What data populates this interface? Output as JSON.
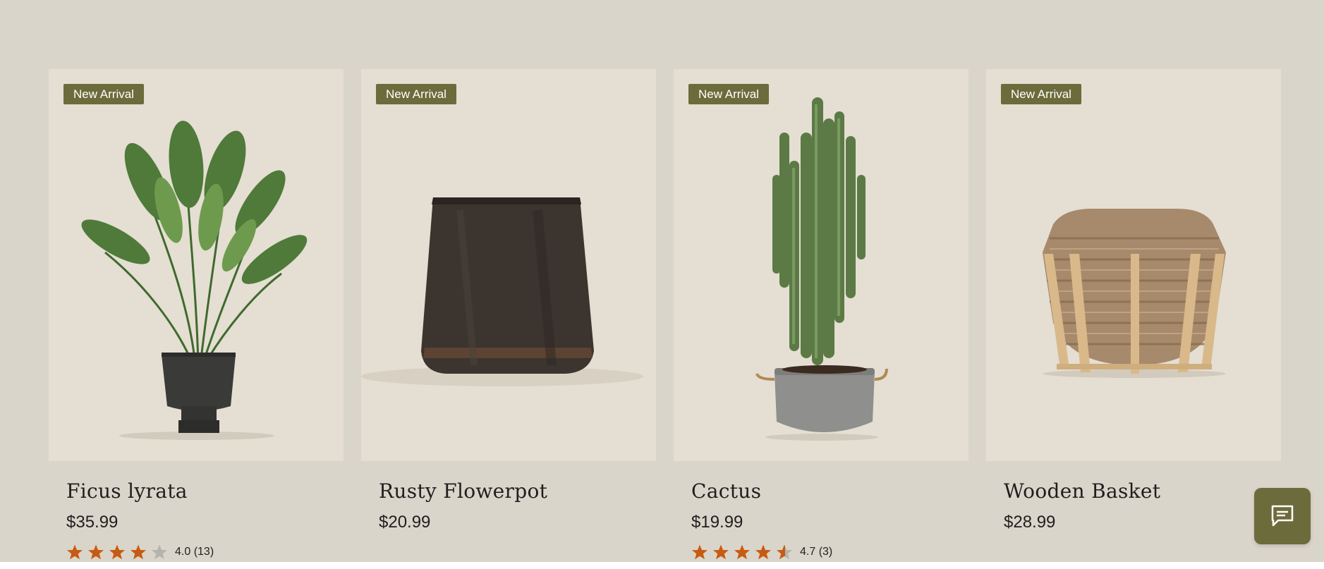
{
  "products": [
    {
      "badge": "New Arrival",
      "name": "Ficus lyrata",
      "price": "$35.99",
      "rating": {
        "stars": 4.0,
        "text": "4.0 (13)"
      },
      "image_icon": "ficus-plant-image"
    },
    {
      "badge": "New Arrival",
      "name": "Rusty Flowerpot",
      "price": "$20.99",
      "rating": null,
      "image_icon": "rusty-pot-image"
    },
    {
      "badge": "New Arrival",
      "name": "Cactus",
      "price": "$19.99",
      "rating": {
        "stars": 4.7,
        "text": "4.7 (3)"
      },
      "image_icon": "cactus-image"
    },
    {
      "badge": "New Arrival",
      "name": "Wooden Basket",
      "price": "$28.99",
      "rating": null,
      "image_icon": "wooden-basket-image"
    }
  ],
  "chat": {
    "icon": "chat-icon"
  },
  "colors": {
    "background": "#dad5ca",
    "card": "#e5ded2",
    "badge": "#6c6b3b",
    "star": "#c75b12",
    "star_empty": "#b5b3ae"
  }
}
